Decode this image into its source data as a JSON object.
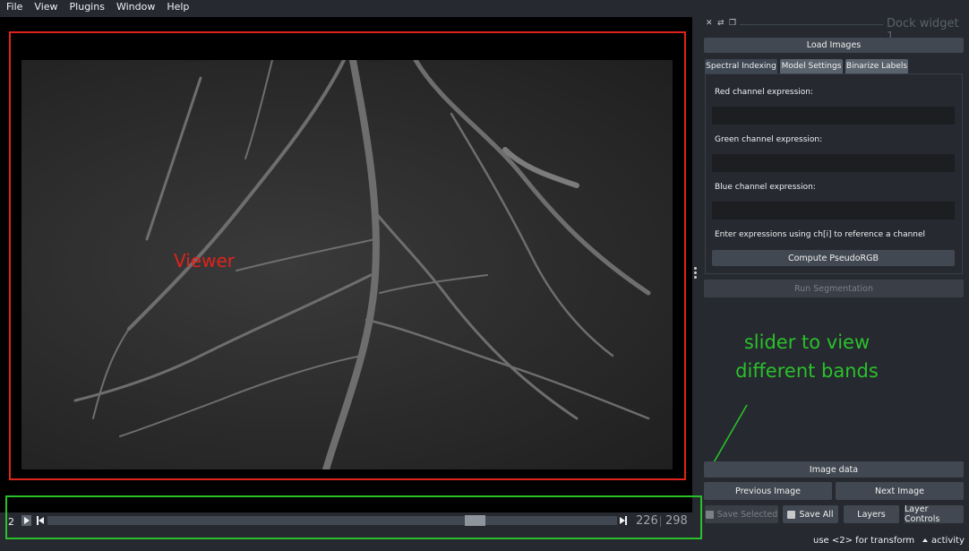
{
  "menu": [
    "File",
    "View",
    "Plugins",
    "Window",
    "Help"
  ],
  "canvas": {
    "annotation_label": "Viewer"
  },
  "dims": {
    "index_label": "2",
    "current_value": "226",
    "max_value": "298",
    "slider_fraction": 0.76
  },
  "dock": {
    "title": "Dock widget 1",
    "controls": [
      "close-icon",
      "float-icon",
      "undock-icon"
    ],
    "load_images": "Load Images",
    "tabs": [
      "Spectral Indexing",
      "Model Settings",
      "Binarize Labels"
    ],
    "active_tab": 0,
    "red_label": "Red channel expression:",
    "green_label": "Green channel expression:",
    "blue_label": "Blue channel expression:",
    "red_value": "",
    "green_value": "",
    "blue_value": "",
    "hint": "Enter expressions using ch[i] to reference a channel",
    "compute_button": "Compute PseudoRGB",
    "run_button": "Run Segmentation",
    "image_data": "Image data",
    "previous_image": "Previous Image",
    "next_image": "Next Image",
    "save_selected": "Save Selected",
    "save_all": "Save All",
    "layers": "Layers",
    "layer_controls": "Layer Controls"
  },
  "annotation": {
    "line1": "slider to view",
    "line2": "different bands"
  },
  "status": {
    "message": "use <2> for transform",
    "activity": "activity"
  },
  "colors": {
    "background": "#262930",
    "button": "#414851",
    "viewer_box": "#e0231c",
    "slider_box": "#2ac02a"
  }
}
